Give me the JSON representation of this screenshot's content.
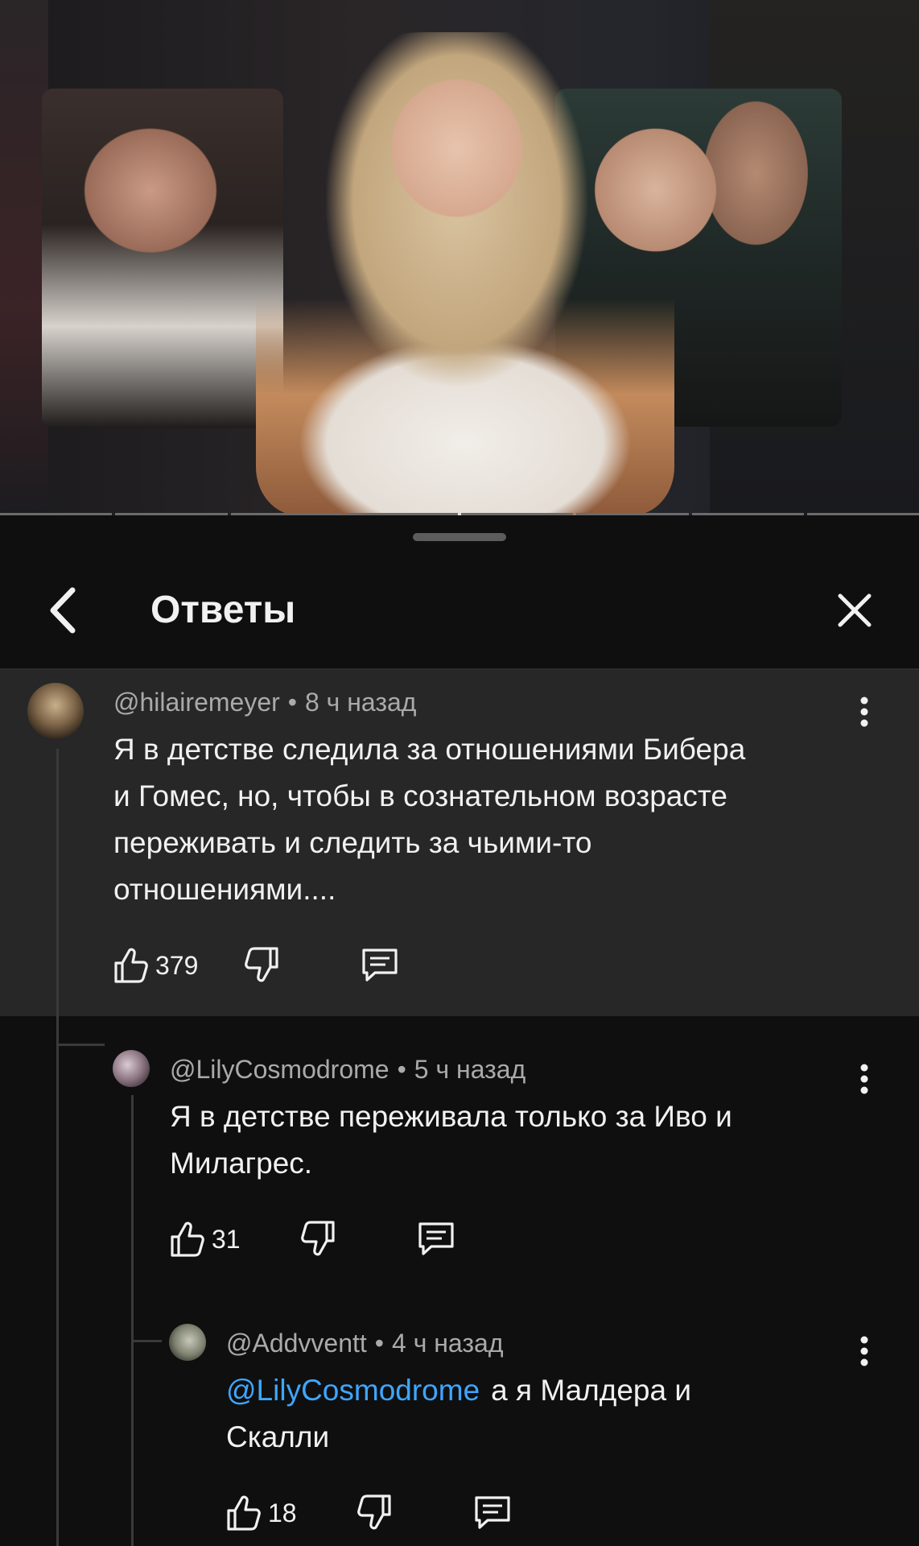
{
  "sheet": {
    "title": "Ответы"
  },
  "icons": {
    "back": "chevron-left-icon",
    "close": "close-icon",
    "like": "thumbs-up-icon",
    "dislike": "thumbs-down-icon",
    "reply": "comment-icon",
    "more": "more-vertical-icon"
  },
  "comments": [
    {
      "author": "@hilairemeyer",
      "time": "8 ч назад",
      "lines": [
        "Я в детстве следила за отношениями Бибера",
        "и Гомес, но, чтобы в сознательном возрасте",
        "переживать и следить за чьими-то",
        "отношениями...."
      ],
      "likes": "379"
    },
    {
      "author": "@LilyCosmodrome",
      "time": "5 ч назад",
      "lines": [
        "Я в детстве переживала только за Иво и",
        "Милагрес."
      ],
      "likes": "31"
    },
    {
      "author": "@Addvventt",
      "time": "4 ч назад",
      "mention": "@LilyCosmodrome",
      "lines": [
        "а я Малдера и",
        "Скалли"
      ],
      "likes": "18"
    }
  ],
  "colors": {
    "background": "#0f0f0f",
    "highlight": "#272727",
    "meta": "#aaaaaa",
    "mention": "#3ea6ff"
  }
}
